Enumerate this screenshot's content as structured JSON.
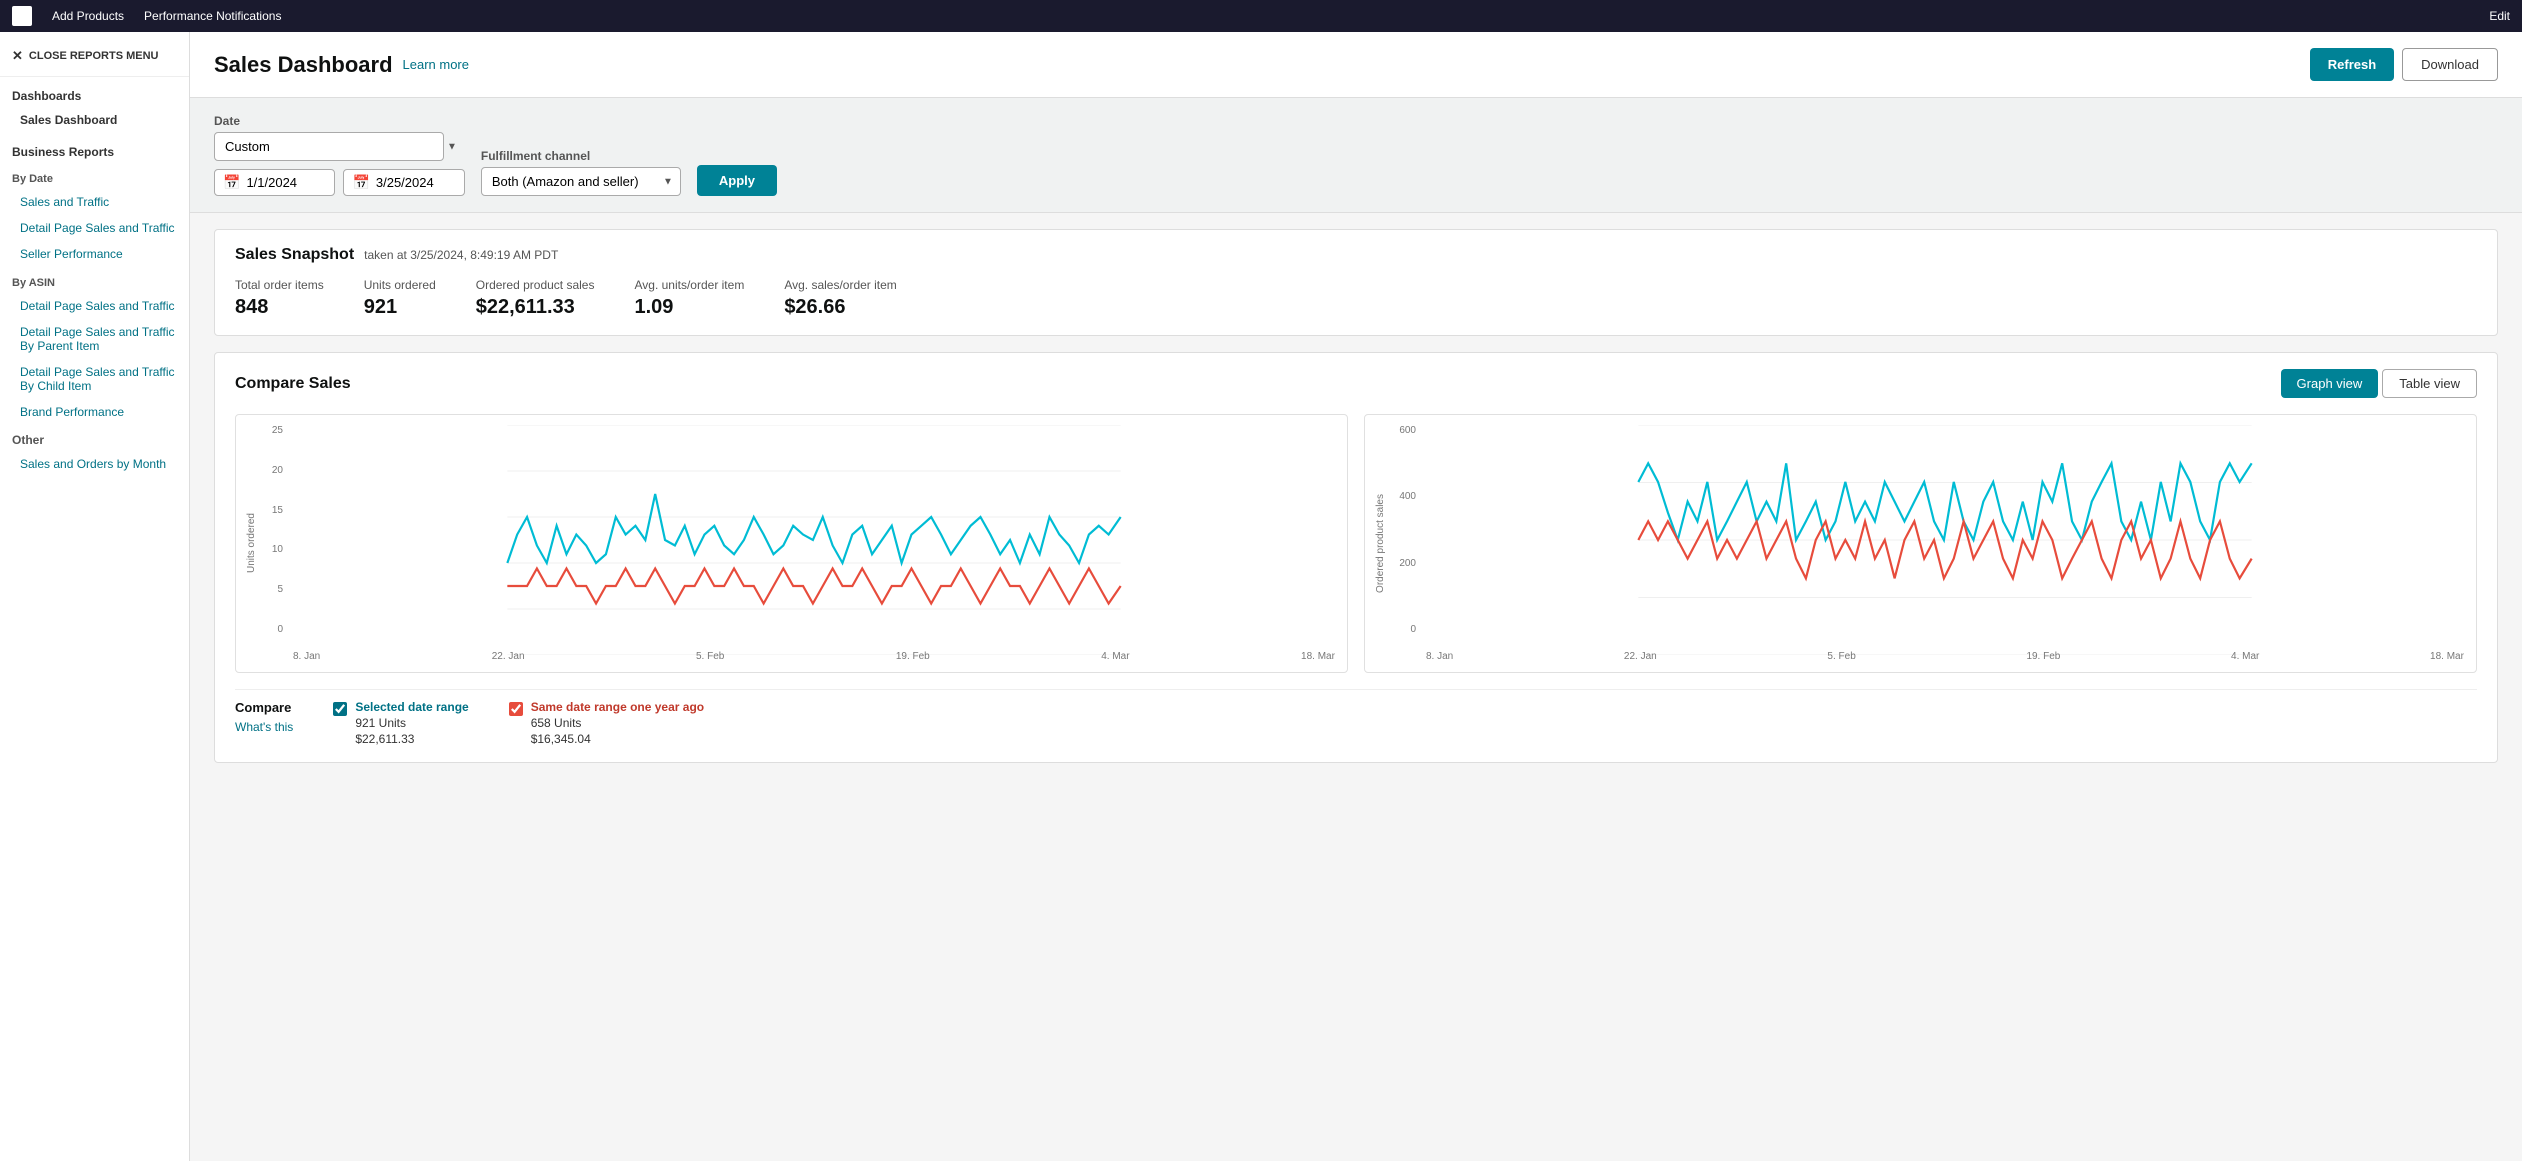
{
  "topnav": {
    "add_products": "Add Products",
    "performance_notifications": "Performance Notifications",
    "edit_label": "Edit"
  },
  "sidebar": {
    "close_menu_label": "CLOSE REPORTS MENU",
    "dashboards_header": "Dashboards",
    "sales_dashboard_item": "Sales Dashboard",
    "business_reports_header": "Business Reports",
    "by_date_header": "By Date",
    "sales_and_traffic_item": "Sales and Traffic",
    "detail_page_sales_traffic_item": "Detail Page Sales and Traffic",
    "seller_performance_item": "Seller Performance",
    "by_asin_header": "By ASIN",
    "detail_page_sales_traffic_asin_item": "Detail Page Sales and Traffic",
    "detail_page_sales_traffic_parent_item": "Detail Page Sales and Traffic By Parent Item",
    "detail_page_sales_traffic_child_item": "Detail Page Sales and Traffic By Child Item",
    "brand_performance_item": "Brand Performance",
    "other_header": "Other",
    "sales_orders_month_item": "Sales and Orders by Month"
  },
  "header": {
    "title": "Sales Dashboard",
    "learn_more": "Learn more",
    "refresh_label": "Refresh",
    "download_label": "Download"
  },
  "filters": {
    "date_label": "Date",
    "date_option": "Custom",
    "fulfillment_label": "Fulfillment channel",
    "fulfillment_option": "Both (Amazon and seller)",
    "apply_label": "Apply",
    "date_from": "1/1/2024",
    "date_to": "3/25/2024"
  },
  "snapshot": {
    "title": "Sales Snapshot",
    "taken_at": "taken at 3/25/2024, 8:49:19 AM PDT",
    "metrics": [
      {
        "label": "Total order items",
        "value": "848"
      },
      {
        "label": "Units ordered",
        "value": "921"
      },
      {
        "label": "Ordered product sales",
        "value": "$22,611.33"
      },
      {
        "label": "Avg. units/order item",
        "value": "1.09"
      },
      {
        "label": "Avg. sales/order item",
        "value": "$26.66"
      }
    ]
  },
  "compare_sales": {
    "title": "Compare Sales",
    "graph_view_label": "Graph view",
    "table_view_label": "Table view",
    "chart_left_y_label": "Units ordered",
    "chart_right_y_label": "Ordered product sales",
    "x_labels_left": [
      "8. Jan",
      "22. Jan",
      "5. Feb",
      "19. Feb",
      "4. Mar",
      "18. Mar"
    ],
    "x_labels_right": [
      "8. Jan",
      "22. Jan",
      "5. Feb",
      "19. Feb",
      "4. Mar",
      "18. Mar"
    ],
    "y_labels_left": [
      "25",
      "20",
      "15",
      "10",
      "5",
      "0"
    ],
    "y_labels_right": [
      "600",
      "400",
      "200",
      "0"
    ],
    "legend": {
      "compare_label": "Compare",
      "whats_this": "What's this",
      "selected_label": "Selected date range",
      "selected_units": "921 Units",
      "selected_sales": "$22,611.33",
      "year_ago_label": "Same date range one year ago",
      "year_ago_units": "658 Units",
      "year_ago_sales": "$16,345.04"
    }
  },
  "colors": {
    "teal": "#008296",
    "selected_line": "#00bcd4",
    "year_ago_line": "#e74c3c",
    "nav_bg": "#1a1a2e"
  }
}
